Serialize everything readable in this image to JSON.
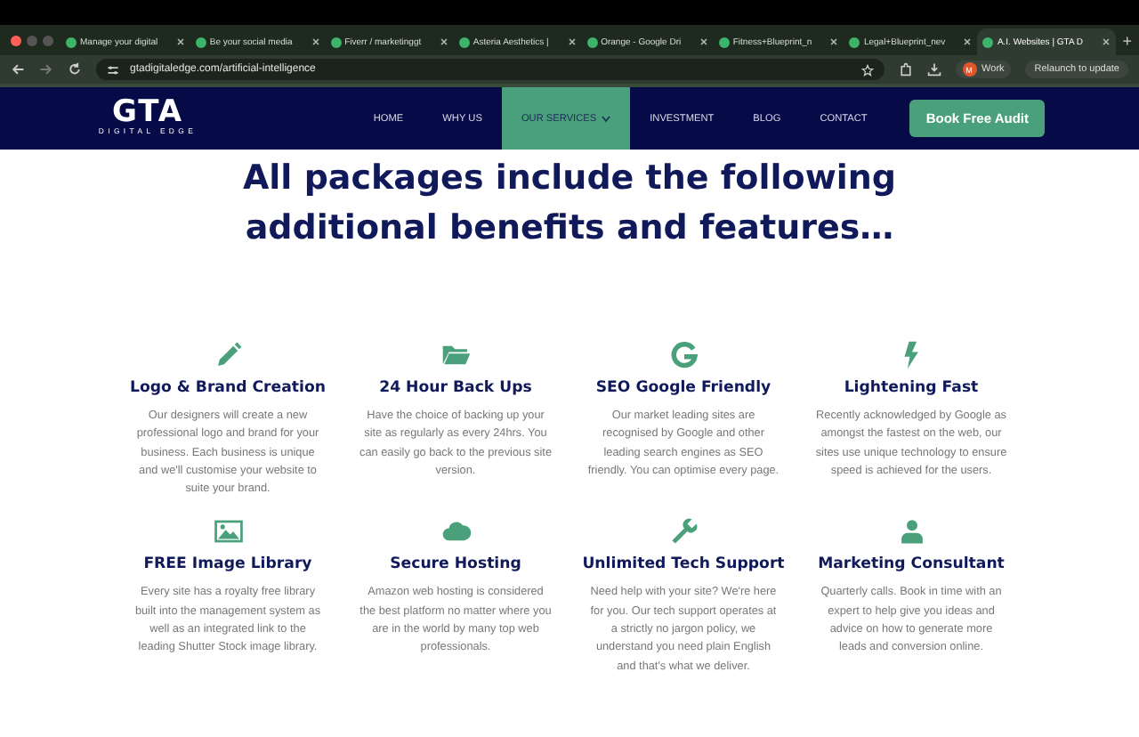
{
  "browser": {
    "tabs": [
      {
        "title": "Manage your digital",
        "selected": false
      },
      {
        "title": "Be your social media",
        "selected": false
      },
      {
        "title": "Fiverr / marketinggt",
        "selected": false
      },
      {
        "title": "Asteria Aesthetics |",
        "selected": false
      },
      {
        "title": "Orange - Google Dri",
        "selected": false
      },
      {
        "title": "Fitness+Blueprint_n",
        "selected": false
      },
      {
        "title": "Legal+Blueprint_nev",
        "selected": false
      },
      {
        "title": "A.I. Websites | GTA D",
        "selected": true
      }
    ],
    "new_tab": "+",
    "url": "gtadigitaledge.com/artificial-intelligence",
    "profile": {
      "initial": "M",
      "name": "Work"
    },
    "relaunch": "Relaunch to update"
  },
  "site": {
    "logo": {
      "mark": "GTA",
      "tagline": "DIGITAL EDGE"
    },
    "nav": [
      {
        "label": "HOME",
        "selected": false
      },
      {
        "label": "WHY US",
        "selected": false
      },
      {
        "label": "OUR SERVICES",
        "selected": true,
        "dropdown": true
      },
      {
        "label": "INVESTMENT",
        "selected": false
      },
      {
        "label": "BLOG",
        "selected": false
      },
      {
        "label": "CONTACT",
        "selected": false
      }
    ],
    "cta": "Book Free Audit"
  },
  "heading": "All packages include the following additional benefits and features…",
  "features": [
    {
      "title": "Logo & Brand Creation",
      "text": "Our designers will create a new professional logo and brand for your business. Each business is unique and we'll customise your website to suite your brand."
    },
    {
      "title": "24 Hour Back Ups",
      "text": "Have the choice of backing up your site as regularly as every 24hrs. You can easily go back to the previous site version."
    },
    {
      "title": "SEO Google Friendly",
      "text": "Our market leading sites are recognised by Google and other leading search engines as SEO friendly. You can optimise every page."
    },
    {
      "title": "Lightening Fast",
      "text": "Recently acknowledged by Google as amongst the fastest on the web, our sites use unique technology to ensure speed is achieved for the users."
    },
    {
      "title": "FREE Image Library",
      "text": "Every site has a royalty free library built into the management system as well as an integrated link to the leading Shutter Stock image library."
    },
    {
      "title": "Secure Hosting",
      "text": "Amazon web hosting is considered the best platform no matter where you are in the world by many top web professionals."
    },
    {
      "title": "Unlimited Tech Support",
      "text": "Need help with your site? We're here for you. Our tech support operates at a strictly no jargon policy, we understand you need plain English and that's what we deliver."
    },
    {
      "title": "Marketing Consultant",
      "text": "Quarterly calls. Book in time with an expert to help give you ideas and advice on how to generate more leads and conversion online."
    }
  ]
}
